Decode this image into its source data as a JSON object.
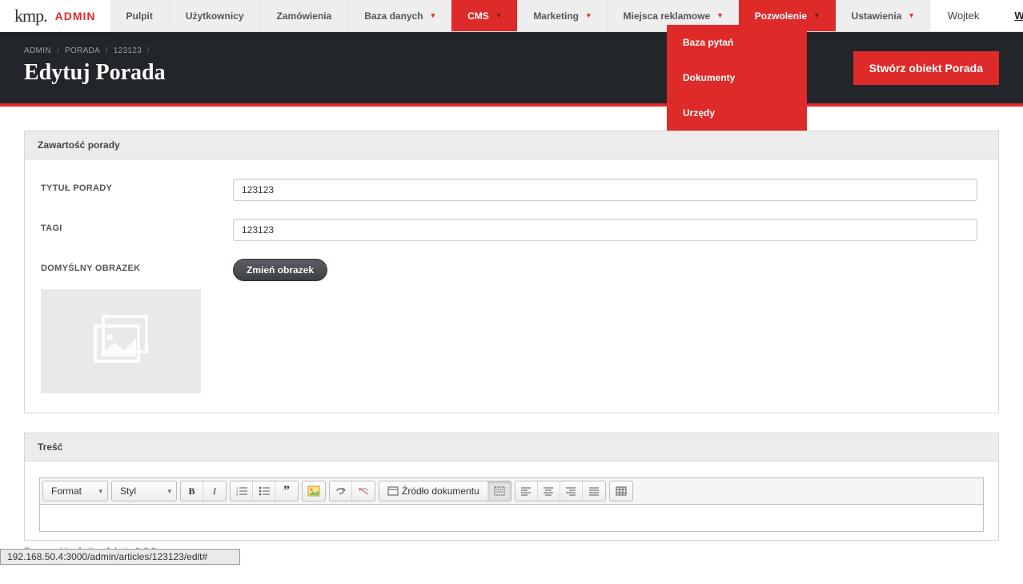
{
  "logo": {
    "brand": "kmp.",
    "admin": "ADMIN"
  },
  "nav": {
    "pulpit": "Pulpit",
    "uzytkownicy": "Użytkownicy",
    "zamowienia": "Zamówienia",
    "baza": "Baza danych",
    "cms": "CMS",
    "marketing": "Marketing",
    "miejsca": "Miejsca reklamowe",
    "pozwolenie": "Pozwolenie",
    "ustawienia": "Ustawienia"
  },
  "dropdown": {
    "bazapytan": "Baza pytań",
    "dokumenty": "Dokumenty",
    "urzedy": "Urzędy"
  },
  "user": {
    "name": "Wojtek",
    "logout": "Wyloguj"
  },
  "breadcrumb": {
    "admin": "ADMIN",
    "porada": "PORADA",
    "id": "123123"
  },
  "page_title": "Edytuj Porada",
  "create_btn": "Stwórz obiekt Porada",
  "panel": {
    "header": "Zawartość porady",
    "field_title": "TYTUŁ PORADY",
    "field_tags": "TAGI",
    "field_image": "DOMYŚLNY OBRAZEK",
    "title_value": "123123",
    "tags_value": "123123",
    "change_image": "Zmień obrazek"
  },
  "panel2": {
    "header": "Treść"
  },
  "editor": {
    "format": "Format",
    "styl": "Styl",
    "source": "Źródło dokumentu"
  },
  "footer": {
    "powered": "Powered by ",
    "link": "Active Admin",
    "ver": " 0.6.3"
  },
  "statusbar": "192.168.50.4:3000/admin/articles/123123/edit#"
}
